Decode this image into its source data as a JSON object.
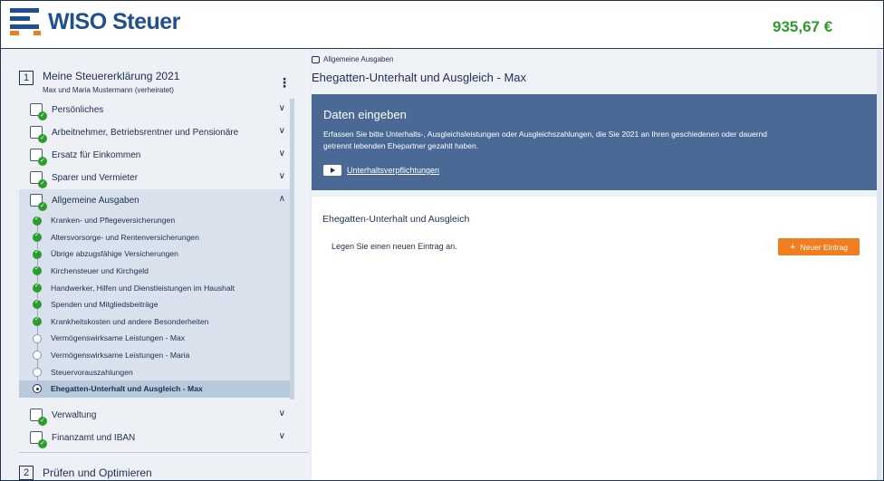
{
  "header": {
    "brand": "WISO Steuer",
    "refund": "935,67 €",
    "colors": {
      "brand": "#1f4f8f",
      "accent": "#f07d1f",
      "refund": "#2f9a2f"
    }
  },
  "sidebar": {
    "section1": {
      "number": "1",
      "title": "Meine Steuererklärung 2021",
      "subtitle": "Max und Maria Mustermann (verheiratet)"
    },
    "items_top": [
      {
        "label": "Persönliches",
        "icon": "person-card-icon"
      },
      {
        "label": "Arbeitnehmer, Betriebsrentner und Pensionäre",
        "icon": "briefcase-icon"
      },
      {
        "label": "Ersatz für Einkommen",
        "icon": "money-hand-icon"
      },
      {
        "label": "Sparer und Vermieter",
        "icon": "piggy-bank-icon"
      }
    ],
    "open_item": {
      "label": "Allgemeine Ausgaben",
      "icon": "wallet-icon"
    },
    "sub_items": [
      {
        "label": "Kranken- und Pflegeversicherungen",
        "status": "done"
      },
      {
        "label": "Altersvorsorge- und Rentenversicherungen",
        "status": "done"
      },
      {
        "label": "Übrige abzugsfähige Versicherungen",
        "status": "done"
      },
      {
        "label": "Kirchensteuer und Kirchgeld",
        "status": "done"
      },
      {
        "label": "Handwerker, Hilfen und Dienstleistungen im Haushalt",
        "status": "done"
      },
      {
        "label": "Spenden und Mitgliedsbeiträge",
        "status": "done"
      },
      {
        "label": "Krankheitskosten und andere Besonderheiten",
        "status": "done"
      },
      {
        "label": "Vermögenswirksame Leistungen - Max",
        "status": "empty"
      },
      {
        "label": "Vermögenswirksame Leistungen - Maria",
        "status": "empty"
      },
      {
        "label": "Steuervorauszahlungen",
        "status": "empty"
      },
      {
        "label": "Ehegatten-Unterhalt und Ausgleich - Max",
        "status": "current"
      }
    ],
    "items_bottom": [
      {
        "label": "Verwaltung",
        "icon": "building-icon"
      },
      {
        "label": "Finanzamt und IBAN",
        "icon": "bank-icon"
      }
    ],
    "section2": {
      "number": "2",
      "title": "Prüfen und Optimieren"
    }
  },
  "main": {
    "breadcrumb": "Allgemeine Ausgaben",
    "title": "Ehegatten-Unterhalt und Ausgleich - Max",
    "info": {
      "title": "Daten eingeben",
      "text": "Erfassen Sie bitte Unterhalts-, Ausgleichsleistungen oder Ausgleichszahlungen, die Sie 2021 an Ihren geschiedenen oder dauernd getrennt lebenden Ehepartner gezahlt haben.",
      "video_link": "Unterhaltsverpflichtungen"
    },
    "entries": {
      "title": "Ehegatten-Unterhalt und Ausgleich",
      "empty_text": "Legen Sie einen neuen Eintrag an.",
      "new_button": "Neuer Eintrag"
    }
  }
}
